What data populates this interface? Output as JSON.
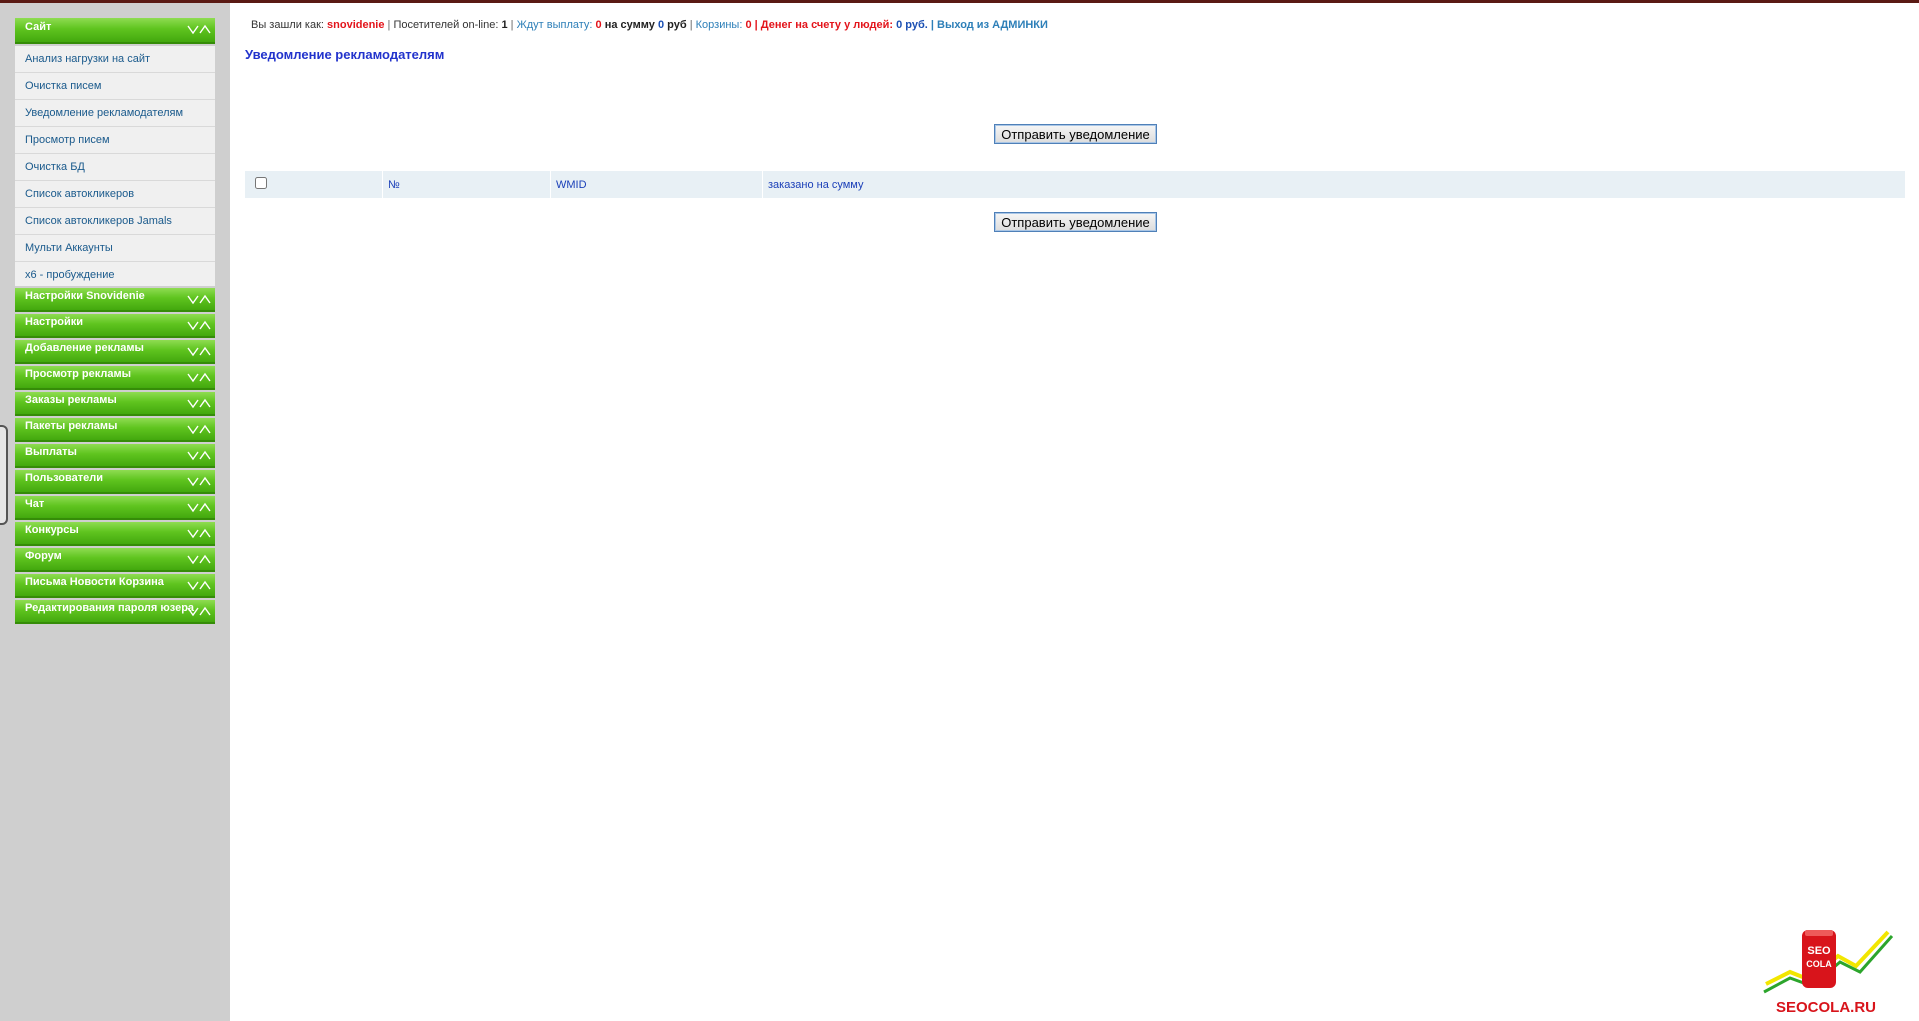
{
  "sidebar": {
    "sections": [
      {
        "label": "Сайт",
        "expanded": true,
        "items": [
          {
            "label": "Анализ нагрузки на сайт"
          },
          {
            "label": "Очистка писем"
          },
          {
            "label": "Уведомление рекламодателям"
          },
          {
            "label": "Просмотр писем"
          },
          {
            "label": "Очистка БД"
          },
          {
            "label": "Список автокликеров"
          },
          {
            "label": "Список автокликеров Jamals"
          },
          {
            "label": "Мульти Аккаунты"
          },
          {
            "label": "x6 - пробуждение"
          }
        ]
      },
      {
        "label": "Настройки Snovidenie"
      },
      {
        "label": "Настройки"
      },
      {
        "label": "Добавление рекламы"
      },
      {
        "label": "Просмотр рекламы"
      },
      {
        "label": "Заказы рекламы"
      },
      {
        "label": "Пакеты рекламы"
      },
      {
        "label": "Выплаты"
      },
      {
        "label": "Пользователи"
      },
      {
        "label": "Чат"
      },
      {
        "label": "Конкурсы"
      },
      {
        "label": "Форум"
      },
      {
        "label": "Письма Новости Корзина"
      },
      {
        "label": "Редактирования пароля юзера"
      }
    ]
  },
  "status": {
    "logged_prefix": "Вы зашли как:",
    "username": "snovidenie",
    "sep": "|",
    "online_label": "Посетителей on-line:",
    "online_count": "1",
    "payout_label": "Ждут выплату:",
    "payout_count": "0",
    "sum_label": "на сумму",
    "sum_value": "0",
    "sum_unit": "руб",
    "carts_label": "Корзины:",
    "carts_count": "0",
    "money_label": "| Денег на счету у людей:",
    "money_value": "0 руб.",
    "logout_label": "| Выход из АДМИНКИ"
  },
  "page": {
    "title": "Уведомление рекламодателям",
    "send_button": "Отправить уведомление"
  },
  "table": {
    "columns": [
      "№",
      "WMID",
      "заказано на сумму"
    ]
  },
  "logo": {
    "text": "SEOCOLA.RU",
    "can_text_top": "SEO",
    "can_text_bottom": "COLA"
  },
  "colors": {
    "accent_green": "#5fc41f",
    "title_blue": "#2233cc",
    "alert_red": "#e3141b",
    "link_blue": "#2d7fb8"
  }
}
